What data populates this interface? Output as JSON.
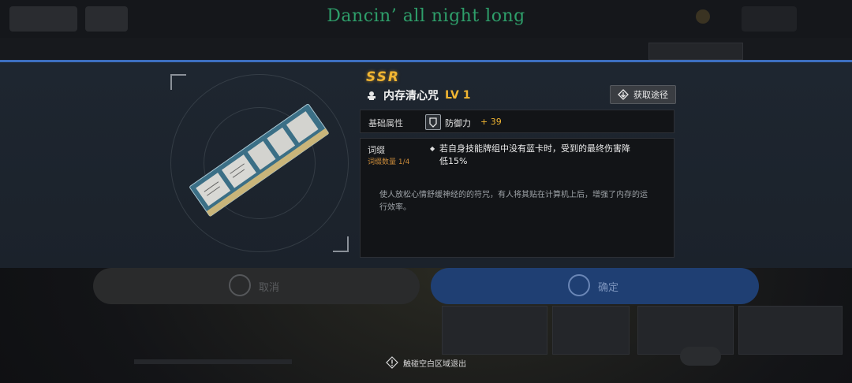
{
  "song_title": "Dancin’ all night long",
  "item": {
    "rarity": "SSR",
    "name": "内存清心咒",
    "level": "LV 1",
    "source_button": "获取途径",
    "base_attr_label": "基础属性",
    "stat_name": "防御力",
    "stat_value": "+ 39",
    "affix_label": "词缀",
    "affix_count": "词缀数量 1/4",
    "affix_effect": "若自身技能牌组中没有蓝卡时，受到的最终伤害降低15%",
    "description": "使人放松心情舒缓神经的的符咒，有人将其贴在计算机上后，增强了内存的运行效率。"
  },
  "background": {
    "cancel_button": "取消",
    "confirm_button": "确定"
  },
  "exit_hint": "触碰空白区域退出",
  "colors": {
    "accent_gold": "#f2b632",
    "panel_border_blue": "#3d6fc0",
    "song_green": "#2e9e6a",
    "confirm_blue": "#2f5ea8"
  }
}
